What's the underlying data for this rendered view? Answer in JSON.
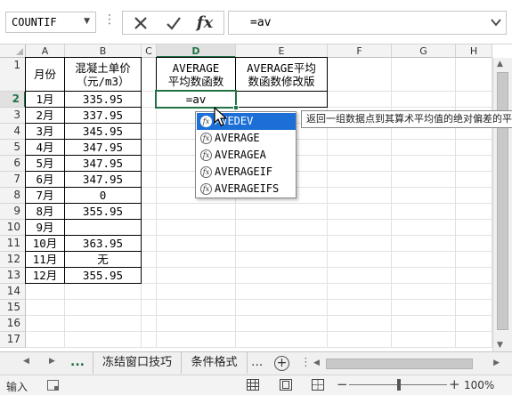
{
  "formula_bar": {
    "name_box": "COUNTIF",
    "formula": "=av"
  },
  "columns": [
    "A",
    "B",
    "C",
    "D",
    "E",
    "F",
    "G",
    "H"
  ],
  "rows": [
    "1",
    "2",
    "3",
    "4",
    "5",
    "6",
    "7",
    "8",
    "9",
    "10",
    "11",
    "12",
    "13",
    "14",
    "15",
    "16",
    "17"
  ],
  "active_cell": "D2",
  "cells": {
    "a1": "月份",
    "b1": "混凝土单价\n（元/m3）",
    "d1": "AVERAGE\n平均数函数",
    "e1": "AVERAGE平均\n数函数修改版",
    "d2": "=av",
    "months": [
      "1月",
      "2月",
      "3月",
      "4月",
      "5月",
      "6月",
      "7月",
      "8月",
      "9月",
      "10月",
      "11月",
      "12月"
    ],
    "prices": [
      "335.95",
      "337.95",
      "345.95",
      "347.95",
      "347.95",
      "347.95",
      "0",
      "355.95",
      "",
      "363.95",
      "无",
      "355.95"
    ]
  },
  "autocomplete": {
    "items": [
      {
        "label": "AVEDEV",
        "selected": true
      },
      {
        "label": "AVERAGE",
        "selected": false
      },
      {
        "label": "AVERAGEA",
        "selected": false
      },
      {
        "label": "AVERAGEIF",
        "selected": false
      },
      {
        "label": "AVERAGEIFS",
        "selected": false
      }
    ],
    "tooltip": "返回一组数据点到其算术平均值的绝对偏差的平均值"
  },
  "sheets": {
    "tabs": [
      "冻结窗口技巧",
      "条件格式"
    ],
    "ellipsis": "..."
  },
  "status": {
    "mode": "输入",
    "zoom": "100%",
    "zoom_minus": "−",
    "zoom_plus": "+"
  },
  "colors": {
    "accent": "#217346",
    "selection": "#1c6fd6"
  }
}
